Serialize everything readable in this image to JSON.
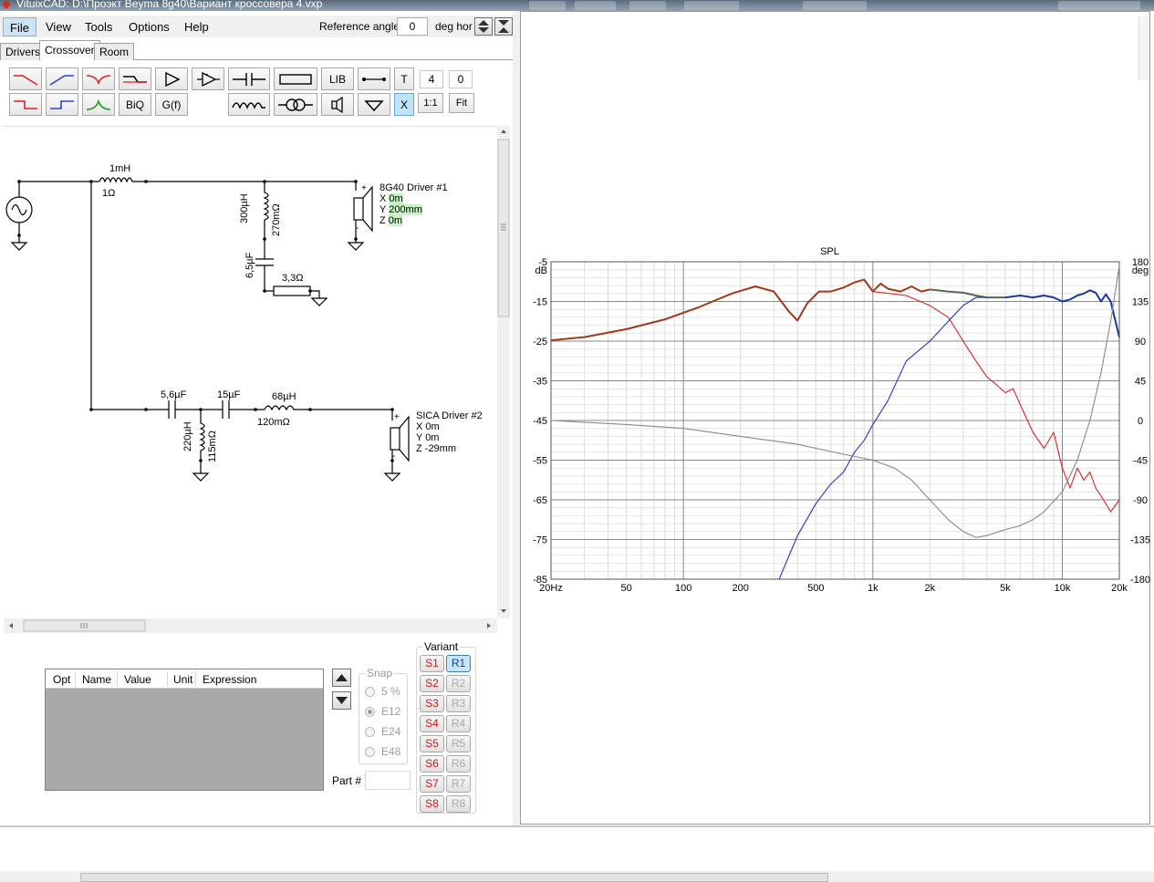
{
  "window": {
    "title": "VituixCAD: D:\\Проэкт Beyma 8g40\\Вариант кроссовера 4.vxp"
  },
  "menu": [
    "File",
    "View",
    "Tools",
    "Options",
    "Help"
  ],
  "reference": {
    "label": "Reference angle",
    "value": "0",
    "unit": "deg hor"
  },
  "tabs": [
    "Drivers",
    "Crossover",
    "Room"
  ],
  "toolbar": {
    "lib": "LIB",
    "t": "T",
    "value1": "4",
    "value2": "0",
    "biq": "BiQ",
    "gf": "G(f)",
    "x": "X",
    "oneone": "1:1",
    "fit": "Fit"
  },
  "schematic": {
    "l1": {
      "value": "1mH",
      "res": "1Ω"
    },
    "l2": {
      "value": "300µH",
      "res": "270mΩ"
    },
    "c1": {
      "value": "6,5µF"
    },
    "r1": {
      "value": "3,3Ω"
    },
    "driver1": {
      "name": "8G40 Driver #1",
      "x": "X",
      "xv": "0m",
      "y": "Y",
      "yv": "200mm",
      "z": "Z",
      "zv": "0m"
    },
    "c2": {
      "value": "5,6µF"
    },
    "c3": {
      "value": "15µF"
    },
    "l3": {
      "value": "68µH",
      "res": "120mΩ"
    },
    "l4": {
      "value": "220µH",
      "res": "115mΩ"
    },
    "driver2": {
      "name": "SICA Driver #2",
      "x": "X 0m",
      "y": "Y 0m",
      "z": "Z -29mm"
    }
  },
  "parts_table": {
    "columns": [
      "Opt",
      "Name",
      "Value",
      "Unit",
      "Expression"
    ]
  },
  "snap": {
    "title": "Snap",
    "options": [
      "5 %",
      "E12",
      "E24",
      "E48"
    ],
    "selected": "E12"
  },
  "part_number": {
    "label": "Part #"
  },
  "variant": {
    "title": "Variant",
    "s": [
      "S1",
      "S2",
      "S3",
      "S4",
      "S5",
      "S6",
      "S7",
      "S8"
    ],
    "r": [
      "R1",
      "R2",
      "R3",
      "R4",
      "R5",
      "R6",
      "R7",
      "R8"
    ],
    "active": "R1"
  },
  "chart_data": {
    "type": "line",
    "title": "SPL",
    "x_scale": "log",
    "x_ticks": [
      "20Hz",
      "50",
      "100",
      "200",
      "500",
      "1k",
      "2k",
      "5k",
      "10k",
      "20k"
    ],
    "x_tick_values": [
      20,
      50,
      100,
      200,
      500,
      1000,
      2000,
      5000,
      10000,
      20000
    ],
    "ylabel_left": "dB",
    "ylim_left": [
      -85,
      -5
    ],
    "y_ticks_left": [
      "-5",
      "-15",
      "-25",
      "-35",
      "-45",
      "-55",
      "-65",
      "-75",
      "-85"
    ],
    "ylabel_right": "deg",
    "ylim_right": [
      -180,
      180
    ],
    "y_ticks_right": [
      "180",
      "135",
      "90",
      "45",
      "0",
      "-45",
      "-90",
      "-135",
      "-180"
    ],
    "grid": true,
    "series": [
      {
        "color": "#a03a1a",
        "x": [
          20,
          30,
          50,
          80,
          120,
          180,
          240,
          300,
          360,
          400,
          450,
          520,
          600,
          700,
          800,
          900,
          1000,
          1100,
          1200,
          1400,
          1600,
          1800,
          2000
        ],
        "y": [
          -24.8,
          -24,
          -22,
          -19.5,
          -16.5,
          -13,
          -11.2,
          -12.5,
          -17.5,
          -19.8,
          -15.5,
          -12.5,
          -12.5,
          -11.5,
          -10.2,
          -9.5,
          -12.5,
          -10.5,
          -11.8,
          -12.5,
          -11.2,
          -12.5,
          -12
        ]
      },
      {
        "color": "#5a6a50",
        "x": [
          2000,
          2500,
          3000,
          3500,
          4000,
          5000
        ],
        "y": [
          -12,
          -12.5,
          -12.8,
          -13.5,
          -14,
          -14
        ]
      },
      {
        "color": "#1a3aa0",
        "x": [
          5000,
          6000,
          7000,
          8000,
          9000,
          10000,
          11000,
          12000,
          13000,
          14000,
          15000,
          16000,
          17000,
          18000,
          20000
        ],
        "y": [
          -14,
          -13.5,
          -14,
          -13.5,
          -14,
          -15,
          -14.5,
          -13.5,
          -13,
          -12.2,
          -12.8,
          -15,
          -13.2,
          -15,
          -24
        ]
      },
      {
        "color": "#e02020",
        "x": [
          1000,
          1500,
          2000,
          2500,
          3000,
          3500,
          4000,
          4500,
          5000,
          5500,
          6000,
          7000,
          8000,
          9000,
          10000,
          11000,
          12000,
          13000,
          14000,
          15000,
          16000,
          18000,
          20000
        ],
        "y": [
          -12.5,
          -13.5,
          -16,
          -19,
          -25,
          -30,
          -34,
          -36,
          -38,
          -37,
          -41,
          -48,
          -52,
          -48,
          -57,
          -62,
          -57,
          -60,
          -58,
          -62,
          -64,
          -68,
          -65
        ]
      },
      {
        "color": "#2233cc",
        "x": [
          320,
          400,
          500,
          600,
          700,
          800,
          900,
          1000,
          1200,
          1500,
          2000,
          2500,
          3000,
          3500,
          4000
        ],
        "y": [
          -85,
          -74,
          -66,
          -61,
          -58,
          -53,
          -50,
          -46,
          -40,
          -30,
          -25,
          -20,
          -16,
          -14,
          -14
        ]
      },
      {
        "color": "#888888",
        "x": [
          20,
          50,
          100,
          200,
          400,
          700,
          1000,
          1300,
          1600,
          2000,
          2500,
          3000,
          3500,
          4000,
          5000,
          6000,
          7000,
          8000,
          10000,
          12000,
          14000,
          16000,
          18000,
          20000
        ],
        "y": [
          -45,
          -46,
          -47,
          -49,
          -51,
          -53.5,
          -55,
          -57,
          -60,
          -65,
          -70,
          -73,
          -74.5,
          -74,
          -72.5,
          -71.5,
          -70,
          -68,
          -63,
          -55,
          -45,
          -33,
          -20,
          -6
        ]
      }
    ]
  }
}
